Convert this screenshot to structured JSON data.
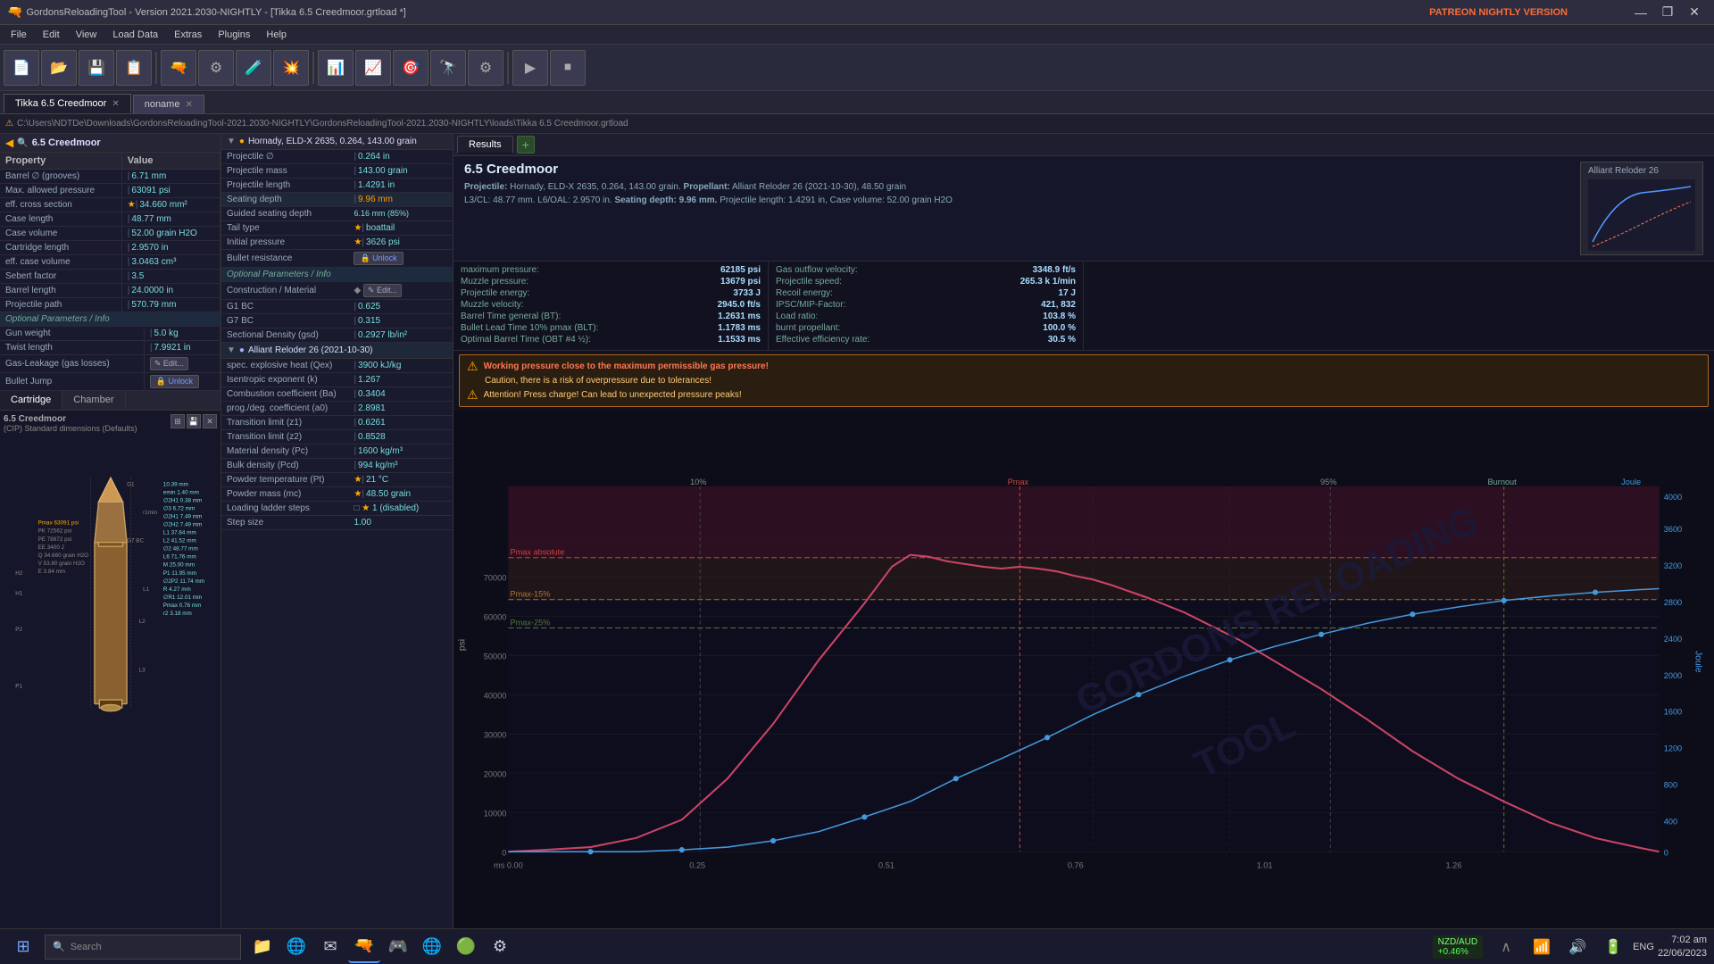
{
  "titlebar": {
    "title": "GordonsReloadingTool - Version 2021.2030-NIGHTLY - [Tikka 6.5 Creedmoor.grtload *]",
    "patreon": "PATREON NIGHTLY VERSION",
    "buttons": [
      "—",
      "❐",
      "✕"
    ]
  },
  "menubar": {
    "items": [
      "File",
      "Edit",
      "View",
      "Load Data",
      "Extras",
      "Plugins",
      "Help"
    ]
  },
  "pathbar": {
    "path": "C:\\Users\\NDTDe\\Downloads\\GordonsReloadingTool-2021.2030-NIGHTLY\\GordonsReloadingTool-2021.2030-NIGHTLY\\loads\\Tikka 6.5 Creedmoor.grtload"
  },
  "tabs": [
    {
      "label": "Tikka 6.5 Creedmoor",
      "active": true
    },
    {
      "label": "noname",
      "active": false
    }
  ],
  "left_panel": {
    "property_header": "Property",
    "value_header": "Value",
    "properties": [
      {
        "name": "6.5 Creedmoor",
        "value": "",
        "type": "header",
        "icon": "bullet"
      },
      {
        "name": "Barrel ∅ (grooves)",
        "value": "6.71 mm",
        "starred": false
      },
      {
        "name": "Max. allowed pressure",
        "value": "63091 psi",
        "starred": false
      },
      {
        "name": "eff. cross section",
        "value": "34.660 mm²",
        "starred": true
      },
      {
        "name": "Case length",
        "value": "48.77 mm",
        "starred": false
      },
      {
        "name": "Case volume",
        "value": "52.00 grain H2O",
        "starred": false
      },
      {
        "name": "Cartridge length",
        "value": "2.9570 in",
        "starred": false
      },
      {
        "name": "eff. case volume",
        "value": "3.0463 cm³",
        "starred": false
      },
      {
        "name": "Sebert factor",
        "value": "3.5",
        "starred": false
      },
      {
        "name": "Barrel length",
        "value": "24.0000 in",
        "starred": false
      },
      {
        "name": "Projectile path",
        "value": "570.79 mm",
        "starred": false
      }
    ],
    "optional_params": "Optional Parameters / Info",
    "optional_properties": [
      {
        "name": "Gun weight",
        "value": "5.0 kg",
        "starred": false
      },
      {
        "name": "Twist length",
        "value": "7.9921 in",
        "starred": false
      },
      {
        "name": "Gas-Leakage (gas losses)",
        "value": "Edit...",
        "starred": false,
        "type": "edit"
      },
      {
        "name": "Bullet Jump",
        "value": "Unlock",
        "starred": false,
        "type": "unlock"
      }
    ]
  },
  "cartridge_tabs": {
    "tabs": [
      "Cartridge",
      "Chamber"
    ],
    "active": "Cartridge",
    "diagram_title": "6.5 Creedmoor",
    "diagram_subtitle": "(CIP) Standard dimensions (Defaults)",
    "dimensions": {
      "Pmax": "63091 psi",
      "PK": "72562 psi",
      "PE": "78872 psi",
      "EE": "3400 J",
      "Q": "34.660 grain H2O",
      "V": "53.80 grain H2O",
      "E": "3.84 mm"
    }
  },
  "middle_panel": {
    "bullet_section": {
      "title": "Hornady, ELD-X 2635, 0.264, 143.00 grain",
      "icon": "bullet",
      "properties": [
        {
          "name": "Projectile ∅",
          "value": "0.264 in"
        },
        {
          "name": "Projectile mass",
          "value": "143.00 grain"
        },
        {
          "name": "Projectile length",
          "value": "1.4291 in"
        },
        {
          "name": "Seating depth",
          "value": "9.96 mm",
          "highlight": true
        },
        {
          "name": "Guided seating depth",
          "value": "6.16 mm (85%)"
        },
        {
          "name": "Tail type",
          "value": "boattail",
          "starred": true
        },
        {
          "name": "Initial pressure",
          "value": "3626 psi",
          "starred": true
        },
        {
          "name": "Bullet resistance",
          "value": "Unlock",
          "type": "unlock"
        }
      ],
      "optional": "Optional Parameters / Info",
      "optional_props": [
        {
          "name": "Construction / Material",
          "value": "Edit...",
          "type": "edit"
        },
        {
          "name": "G1 BC",
          "value": "0.625"
        },
        {
          "name": "G7 BC",
          "value": "0.315"
        },
        {
          "name": "Sectional Density (gsd)",
          "value": "0.2927 lb/in²"
        }
      ]
    },
    "powder_section": {
      "title": "Alliant Reloder 26 (2021-10-30)",
      "icon": "powder",
      "properties": [
        {
          "name": "spec. explosive heat (Qex)",
          "value": "3900 kJ/kg"
        },
        {
          "name": "Isentropic exponent (k)",
          "value": "1.267"
        },
        {
          "name": "Combustion coefficient (Ba)",
          "value": "0.3404"
        },
        {
          "name": "prog./deg. coefficient (a0)",
          "value": "2.8981"
        },
        {
          "name": "Transition limit (z1)",
          "value": "0.6261"
        },
        {
          "name": "Transition limit (z2)",
          "value": "0.8528"
        },
        {
          "name": "Material density (Pc)",
          "value": "1600 kg/m³"
        },
        {
          "name": "Bulk density (Pcd)",
          "value": "994 kg/m³"
        },
        {
          "name": "Powder temperature (Pt)",
          "value": "21 °C",
          "starred": true
        },
        {
          "name": "Powder mass (mc)",
          "value": "48.50 grain",
          "starred": true
        },
        {
          "name": "Loading ladder steps",
          "value": "1 (disabled)"
        },
        {
          "name": "Step size",
          "value": "1.00"
        }
      ]
    }
  },
  "results": {
    "tab_label": "Results",
    "title": "6.5 Creedmoor",
    "subtitle_projectile": "Hornady, ELD-X 2635, 0.264, 143.00 grain.",
    "subtitle_propellant": "Propellant: Alliant Reloder 26 (2021-10-30), 48.50 grain",
    "subtitle_l3": "L3/CL: 48.77 mm. L6/OAL: 2.9570 in. Seating depth: 9.96 mm. Projectile length: 1.4291 in, Case volume: 52.00 grain H2O",
    "stats": {
      "col1": [
        {
          "label": "maximum pressure:",
          "value": "62185 psi"
        },
        {
          "label": "Muzzle pressure:",
          "value": "13679 psi"
        },
        {
          "label": "Projectile energy:",
          "value": "3733 J"
        },
        {
          "label": "Muzzle velocity:",
          "value": "2945.0 ft/s"
        },
        {
          "label": "Barrel Time general (BT):",
          "value": "1.2631 ms"
        },
        {
          "label": "Bullet Lead Time 10% pmax (BLT):",
          "value": "1.1783 ms"
        },
        {
          "label": "Optimal Barrel Time (OBT #4 ½):",
          "value": "1.1533 ms"
        }
      ],
      "col2": [
        {
          "label": "Gas outflow velocity:",
          "value": "3348.9 ft/s"
        },
        {
          "label": "Projectile speed:",
          "value": "265.3 k 1/min"
        },
        {
          "label": "Recoil energy:",
          "value": "17 J"
        },
        {
          "label": "IPSC/MIP-Factor:",
          "value": "421, 832"
        },
        {
          "label": "Load ratio:",
          "value": "103.8 %"
        },
        {
          "label": "burnt propellant:",
          "value": "100.0 %"
        },
        {
          "label": "Effective efficiency rate:",
          "value": "30.5 %"
        }
      ]
    },
    "warnings": [
      {
        "text": "Working pressure close to the maximum permissible gas pressure!",
        "type": "warning"
      },
      {
        "text": "Caution, there is a risk of overpressure due to tolerances!",
        "type": "warning"
      },
      {
        "text": "Attention! Press charge! Can lead to unexpected pressure peaks!",
        "type": "warning"
      }
    ],
    "chart": {
      "y_label_left": "psi",
      "y_label_right": "Joule",
      "x_label": "ms",
      "markers": [
        "10%",
        "Pmax",
        "95%",
        "Burnout",
        "Joule"
      ],
      "y_markers_left": [
        "Pmax absolute",
        "Pmax-15%",
        "Pmax-25%"
      ],
      "x_axis_values": [
        "0.00",
        "0.25",
        "0.51",
        "0.76",
        "1.01",
        "1.26"
      ],
      "y_axis_values_psi": [
        "0",
        "10000",
        "20000",
        "30000",
        "40000",
        "50000",
        "60000",
        "70000"
      ],
      "y_axis_values_joule": [
        "0",
        "400",
        "800",
        "1200",
        "1600",
        "2000",
        "2400",
        "2800",
        "3200",
        "3600",
        "4000"
      ],
      "watermark": "GORDONS RELOADING TOOL"
    },
    "top_right": {
      "label": "Alliant Reloder 26"
    }
  },
  "taskbar": {
    "search_placeholder": "Search",
    "ticker": {
      "label": "NZD/AUD",
      "change": "+0.46%"
    },
    "time": "7:02 am",
    "date": "22/06/2023",
    "language": "ENG",
    "pinned_apps": [
      "⊞",
      "🔍",
      "📁",
      "🌐",
      "📧"
    ]
  }
}
